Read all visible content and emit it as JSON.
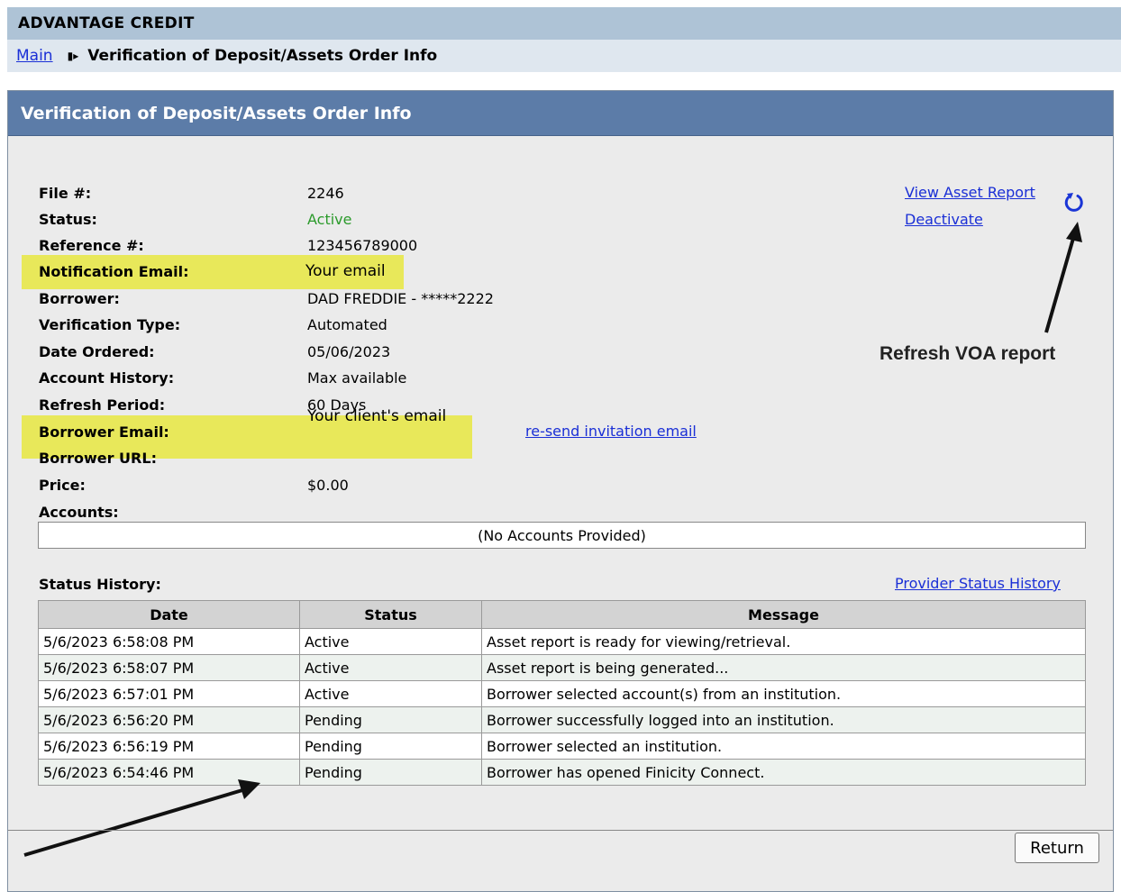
{
  "header": {
    "brand": "ADVANTAGE CREDIT"
  },
  "breadcrumb": {
    "main": "Main",
    "separator": "▮▸",
    "current": "Verification of Deposit/Assets Order Info"
  },
  "panel": {
    "title": "Verification of Deposit/Assets Order Info"
  },
  "fields": {
    "file_label": "File #:",
    "file_value": "2246",
    "status_label": "Status:",
    "status_value": "Active",
    "reference_label": "Reference #:",
    "reference_value": "123456789000",
    "notification_email_label": "Notification Email:",
    "notification_email_value": "Your email",
    "borrower_label": "Borrower:",
    "borrower_value": "DAD FREDDIE - *****2222",
    "verification_type_label": "Verification Type:",
    "verification_type_value": "Automated",
    "date_ordered_label": "Date Ordered:",
    "date_ordered_value": "05/06/2023",
    "account_history_label": "Account History:",
    "account_history_value": "Max available",
    "refresh_period_label": "Refresh Period:",
    "refresh_period_value": "60 Days",
    "borrower_email_label": "Borrower Email:",
    "borrower_email_value": "Your client's email",
    "borrower_url_label": "Borrower URL:",
    "price_label": "Price:",
    "price_value": "$0.00",
    "accounts_label": "Accounts:"
  },
  "links": {
    "view_asset_report": "View Asset Report",
    "deactivate": "Deactivate",
    "resend_invitation": "re-send invitation email",
    "provider_status_history": "Provider Status History"
  },
  "accounts": {
    "empty_text": "(No Accounts Provided)"
  },
  "status_history": {
    "label": "Status History:",
    "columns": {
      "date": "Date",
      "status": "Status",
      "message": "Message"
    },
    "rows": [
      {
        "date": "5/6/2023 6:58:08 PM",
        "status": "Active",
        "message": "Asset report is ready for viewing/retrieval."
      },
      {
        "date": "5/6/2023 6:58:07 PM",
        "status": "Active",
        "message": "Asset report is being generated..."
      },
      {
        "date": "5/6/2023 6:57:01 PM",
        "status": "Active",
        "message": "Borrower selected account(s) from an institution."
      },
      {
        "date": "5/6/2023 6:56:20 PM",
        "status": "Pending",
        "message": "Borrower successfully logged into an institution."
      },
      {
        "date": "5/6/2023 6:56:19 PM",
        "status": "Pending",
        "message": "Borrower selected an institution."
      },
      {
        "date": "5/6/2023 6:54:46 PM",
        "status": "Pending",
        "message": "Borrower has opened Finicity Connect."
      }
    ]
  },
  "buttons": {
    "return": "Return"
  },
  "annotations": {
    "refresh_voa": "Refresh VOA report"
  },
  "icons": {
    "refresh": "refresh-icon",
    "breadcrumb_separator": "breadcrumb-arrow-icon"
  },
  "colors": {
    "header_bar": "#aec3d6",
    "panel_title_bg": "#5c7ca8",
    "highlight": "#e8e85a",
    "link": "#1a2fd6",
    "active_status": "#2b9a2b"
  }
}
